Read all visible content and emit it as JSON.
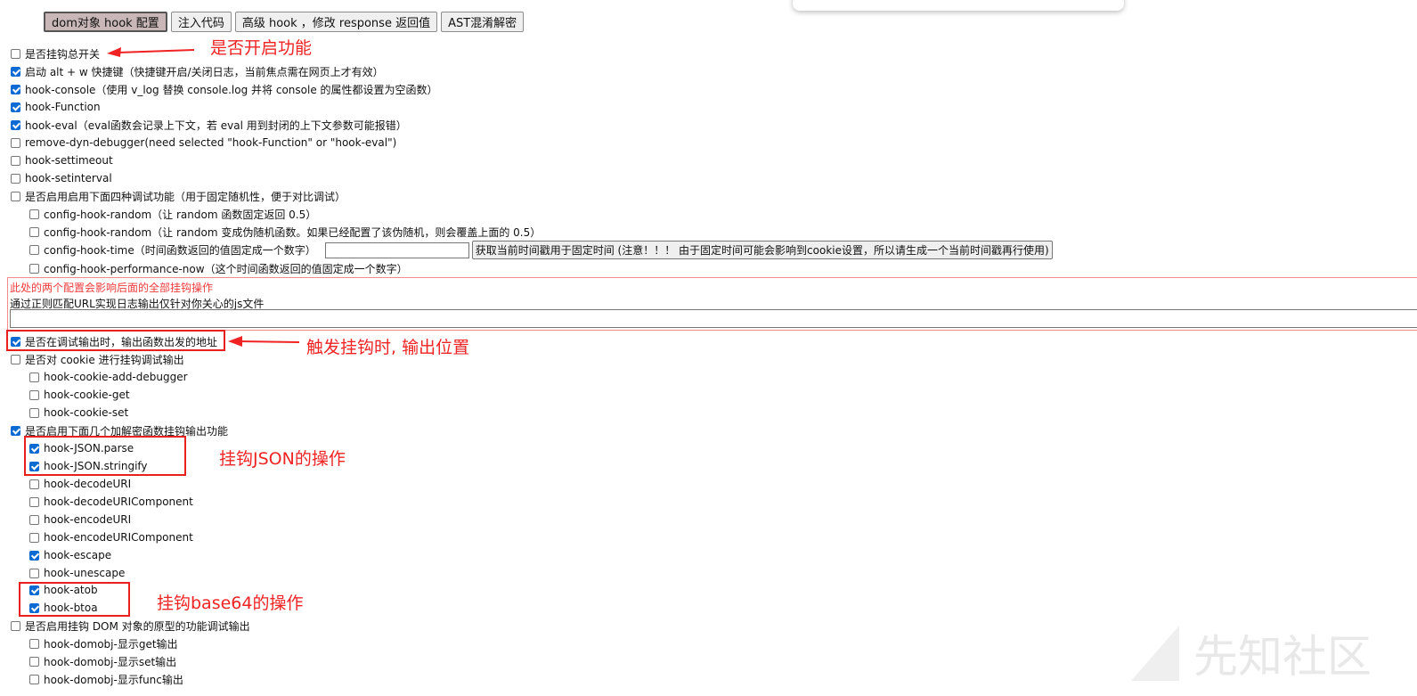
{
  "tabs": [
    {
      "label": "dom对象 hook 配置",
      "active": true
    },
    {
      "label": "注入代码",
      "active": false
    },
    {
      "label": "高级 hook ，修改 response 返回值",
      "active": false
    },
    {
      "label": "AST混淆解密",
      "active": false
    }
  ],
  "options": [
    {
      "label": "是否挂钩总开关",
      "checked": false
    },
    {
      "label": "启动 alt + w 快捷键（快捷键开启/关闭日志，当前焦点需在网页上才有效）",
      "checked": true
    },
    {
      "label": "hook-console（使用 v_log 替换 console.log 并将 console 的属性都设置为空函数）",
      "checked": true
    },
    {
      "label": "hook-Function",
      "checked": true
    },
    {
      "label": "hook-eval（eval函数会记录上下文，若 eval 用到封闭的上下文参数可能报错）",
      "checked": true
    },
    {
      "label": "remove-dyn-debugger(need selected \"hook-Function\" or \"hook-eval\")",
      "checked": false
    },
    {
      "label": "hook-settimeout",
      "checked": false
    },
    {
      "label": "hook-setinterval",
      "checked": false
    },
    {
      "label": "是否启用启用下面四种调试功能（用于固定随机性，便于对比调试）",
      "checked": false
    },
    {
      "label": "config-hook-random（让 random 函数固定返回 0.5）",
      "checked": false
    },
    {
      "label": "config-hook-random（让 random 变成伪随机函数。如果已经配置了该伪随机，则会覆盖上面的 0.5）",
      "checked": false
    },
    {
      "label": "config-hook-time（时间函数返回的值固定成一个数字）",
      "checked": false
    },
    {
      "label": "config-hook-performance-now（这个时间函数返回的值固定成一个数字）",
      "checked": false
    },
    {
      "label": "是否在调试输出时，输出函数出发的地址",
      "checked": true
    },
    {
      "label": "是否对 cookie 进行挂钩调试输出",
      "checked": false
    },
    {
      "label": "hook-cookie-add-debugger",
      "checked": false
    },
    {
      "label": "hook-cookie-get",
      "checked": false
    },
    {
      "label": "hook-cookie-set",
      "checked": false
    },
    {
      "label": "是否启用下面几个加解密函数挂钩输出功能",
      "checked": true
    },
    {
      "label": "hook-JSON.parse",
      "checked": true
    },
    {
      "label": "hook-JSON.stringify",
      "checked": true
    },
    {
      "label": "hook-decodeURI",
      "checked": false
    },
    {
      "label": "hook-decodeURIComponent",
      "checked": false
    },
    {
      "label": "hook-encodeURI",
      "checked": false
    },
    {
      "label": "hook-encodeURIComponent",
      "checked": false
    },
    {
      "label": "hook-escape",
      "checked": true
    },
    {
      "label": "hook-unescape",
      "checked": false
    },
    {
      "label": "hook-atob",
      "checked": true
    },
    {
      "label": "hook-btoa",
      "checked": true
    },
    {
      "label": "是否启用挂钩 DOM 对象的原型的功能调试输出",
      "checked": false
    },
    {
      "label": "hook-domobj-显示get输出",
      "checked": false
    },
    {
      "label": "hook-domobj-显示set输出",
      "checked": false
    },
    {
      "label": "hook-domobj-显示func输出",
      "checked": false
    }
  ],
  "time_config": {
    "input_value": "",
    "button_label": "获取当前时间戳用于固定时间 (注意！！！ 由于固定时间可能会影响到cookie设置，所以请生成一个当前时间戳再行使用)"
  },
  "regex_config": {
    "warning": "此处的两个配置会影响后面的全部挂钩操作",
    "description": "通过正则匹配URL实现日志输出仅针对你关心的js文件",
    "input_value": ""
  },
  "annotations": {
    "master_switch": "是否开启功能",
    "output_location": "触发挂钩时, 输出位置",
    "json_hook": "挂钩JSON的操作",
    "base64_hook": "挂钩base64的操作"
  },
  "watermark": "先知社区",
  "colors": {
    "annotation_red": "#ef2323",
    "checkbox_blue": "#0b6bd3",
    "warning_red": "#ef3b3b"
  }
}
